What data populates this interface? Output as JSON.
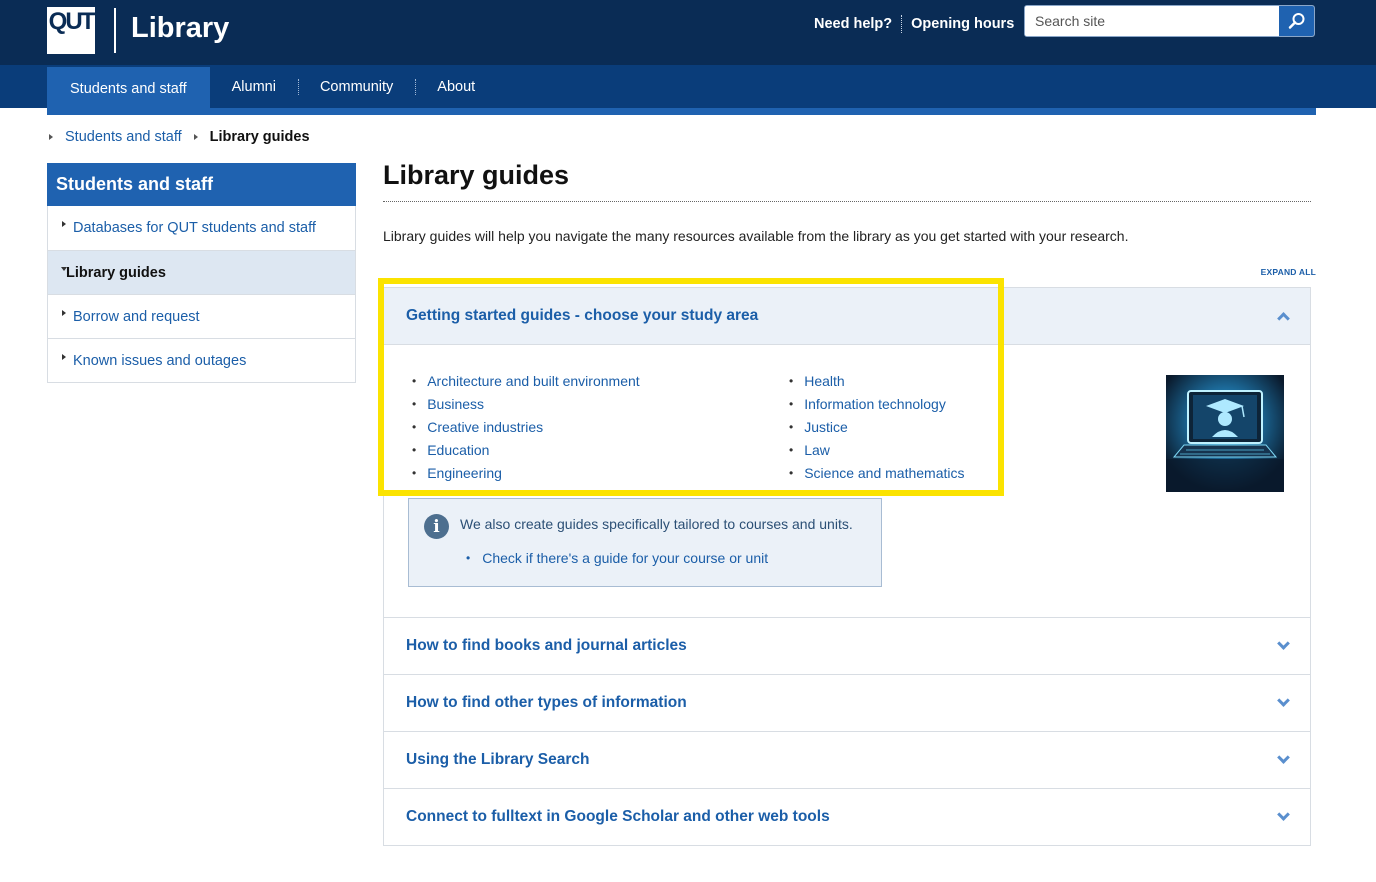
{
  "header": {
    "logo_text": "QUT",
    "site_title": "Library",
    "need_help": "Need help?",
    "opening_hours": "Opening hours",
    "search_placeholder": "Search site"
  },
  "nav": {
    "items": [
      {
        "label": "Students and staff",
        "active": true
      },
      {
        "label": "Alumni"
      },
      {
        "label": "Community"
      },
      {
        "label": "About"
      }
    ]
  },
  "breadcrumb": {
    "parent": "Students and staff",
    "current": "Library guides"
  },
  "sidebar": {
    "heading": "Students and staff",
    "items": [
      {
        "label": "Databases for QUT students and staff"
      },
      {
        "label": "Library guides",
        "current": true
      },
      {
        "label": "Borrow and request"
      },
      {
        "label": "Known issues and outages"
      }
    ]
  },
  "main": {
    "title": "Library guides",
    "intro": "Library guides will help you navigate the many resources available from the library as you get started with your research.",
    "expand_all": "EXPAND ALL",
    "accordion": [
      {
        "title": "Getting started guides - choose your study area",
        "open": true,
        "guides_left": [
          "Architecture and built environment",
          "Business",
          "Creative industries",
          "Education",
          "Engineering"
        ],
        "guides_right": [
          "Health",
          "Information technology",
          "Justice",
          "Law",
          "Science and mathematics"
        ],
        "info_text": "We also create guides specifically tailored to courses and units.",
        "info_link": "Check if there's a guide for your course or unit"
      },
      {
        "title": "How to find books and journal articles"
      },
      {
        "title": "How to find other types of information"
      },
      {
        "title": "Using the Library Search"
      },
      {
        "title": "Connect to fulltext in Google Scholar and other web tools"
      }
    ]
  },
  "colors": {
    "header_bg": "#0a2c55",
    "nav_bg": "#0a3d7a",
    "accent": "#1f62b0",
    "link": "#1b5ea8",
    "highlight": "#fbe300"
  }
}
